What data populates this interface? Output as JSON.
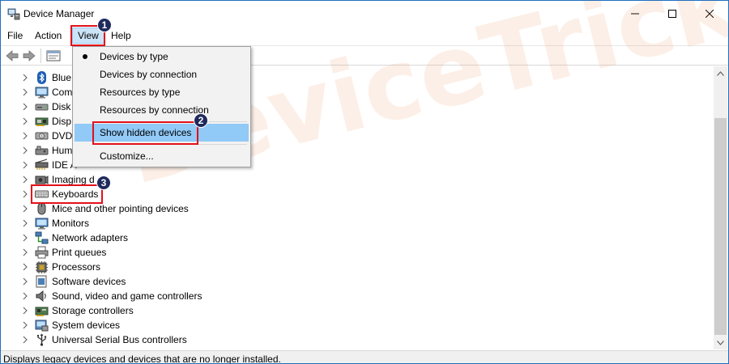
{
  "window": {
    "title": "Device Manager"
  },
  "menubar": {
    "items": [
      "File",
      "Action",
      "View",
      "Help"
    ]
  },
  "view_menu": {
    "items": [
      {
        "label": "Devices by type",
        "selected": true
      },
      {
        "label": "Devices by connection"
      },
      {
        "label": "Resources by type"
      },
      {
        "label": "Resources by connection"
      },
      {
        "label": "Show hidden devices",
        "highlighted": true
      },
      {
        "label": "Customize..."
      }
    ]
  },
  "tree": {
    "items": [
      {
        "label": "Blue",
        "icon": "bluetooth-icon"
      },
      {
        "label": "Com",
        "icon": "computer-icon"
      },
      {
        "label": "Disk",
        "icon": "disk-drive-icon"
      },
      {
        "label": "Disp",
        "icon": "display-adapter-icon"
      },
      {
        "label": "DVD",
        "icon": "dvd-drive-icon"
      },
      {
        "label": "Hum",
        "icon": "hid-icon"
      },
      {
        "label": "IDE A",
        "icon": "ide-controller-icon"
      },
      {
        "label": "Imaging d",
        "icon": "camera-icon"
      },
      {
        "label": "Keyboards",
        "icon": "keyboard-icon"
      },
      {
        "label": "Mice and other pointing devices",
        "icon": "mouse-icon"
      },
      {
        "label": "Monitors",
        "icon": "monitor-icon"
      },
      {
        "label": "Network adapters",
        "icon": "network-adapter-icon"
      },
      {
        "label": "Print queues",
        "icon": "printer-icon"
      },
      {
        "label": "Processors",
        "icon": "processor-icon"
      },
      {
        "label": "Software devices",
        "icon": "software-device-icon"
      },
      {
        "label": "Sound, video and game controllers",
        "icon": "speaker-icon"
      },
      {
        "label": "Storage controllers",
        "icon": "storage-controller-icon"
      },
      {
        "label": "System devices",
        "icon": "system-device-icon"
      },
      {
        "label": "Universal Serial Bus controllers",
        "icon": "usb-icon"
      }
    ]
  },
  "status_bar": {
    "text": "Displays legacy devices and devices that are no longer installed."
  },
  "annotations": {
    "step1": "1",
    "step2": "2",
    "step3": "3"
  },
  "watermark": {
    "text": "DeviceTricks"
  },
  "colors": {
    "annotation_red": "#e3101a",
    "badge_navy": "#1f2a5c",
    "highlight_blue": "#91c9f7",
    "watermark_orange": "#e6783c"
  }
}
